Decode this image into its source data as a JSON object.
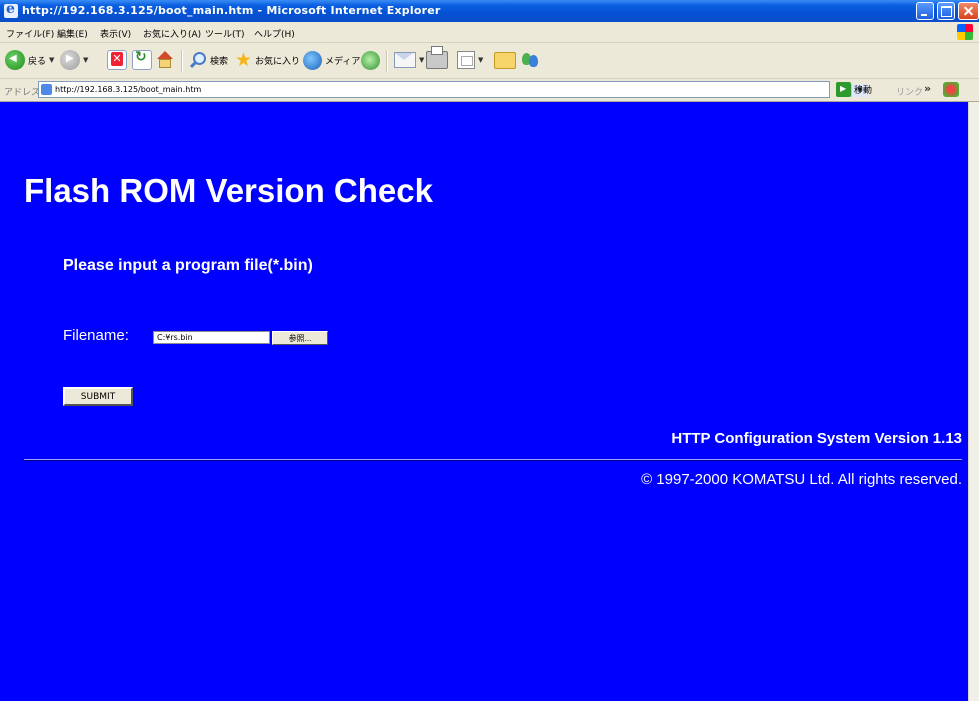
{
  "window": {
    "title": "http://192.168.3.125/boot_main.htm - Microsoft Internet Explorer"
  },
  "menubar": {
    "items": [
      "ファイル(F)",
      "編集(E)",
      "表示(V)",
      "お気に入り(A)",
      "ツール(T)",
      "ヘルプ(H)"
    ]
  },
  "toolbar": {
    "back_label": "戻る",
    "search_label": "検索",
    "favorites_label": "お気に入り",
    "media_label": "メディア"
  },
  "address_bar": {
    "label": "アドレス(D)",
    "url": "http://192.168.3.125/boot_main.htm",
    "go_label": "移動",
    "links_label": "リンク",
    "chevron": "»"
  },
  "page": {
    "title": "Flash ROM Version Check",
    "instruction": "Please input a program file(*.bin)",
    "filename_label": "Filename:",
    "filename_value": "C:¥rs.bin",
    "browse_label": "参照...",
    "submit_label": "SUBMIT",
    "version": "HTTP Configuration System Version 1.13",
    "copyright": "© 1997-2000 KOMATSU Ltd. All rights reserved."
  },
  "colors": {
    "page_background": "#0000ff",
    "titlebar": "#0550d4",
    "chrome": "#ece9d8"
  }
}
